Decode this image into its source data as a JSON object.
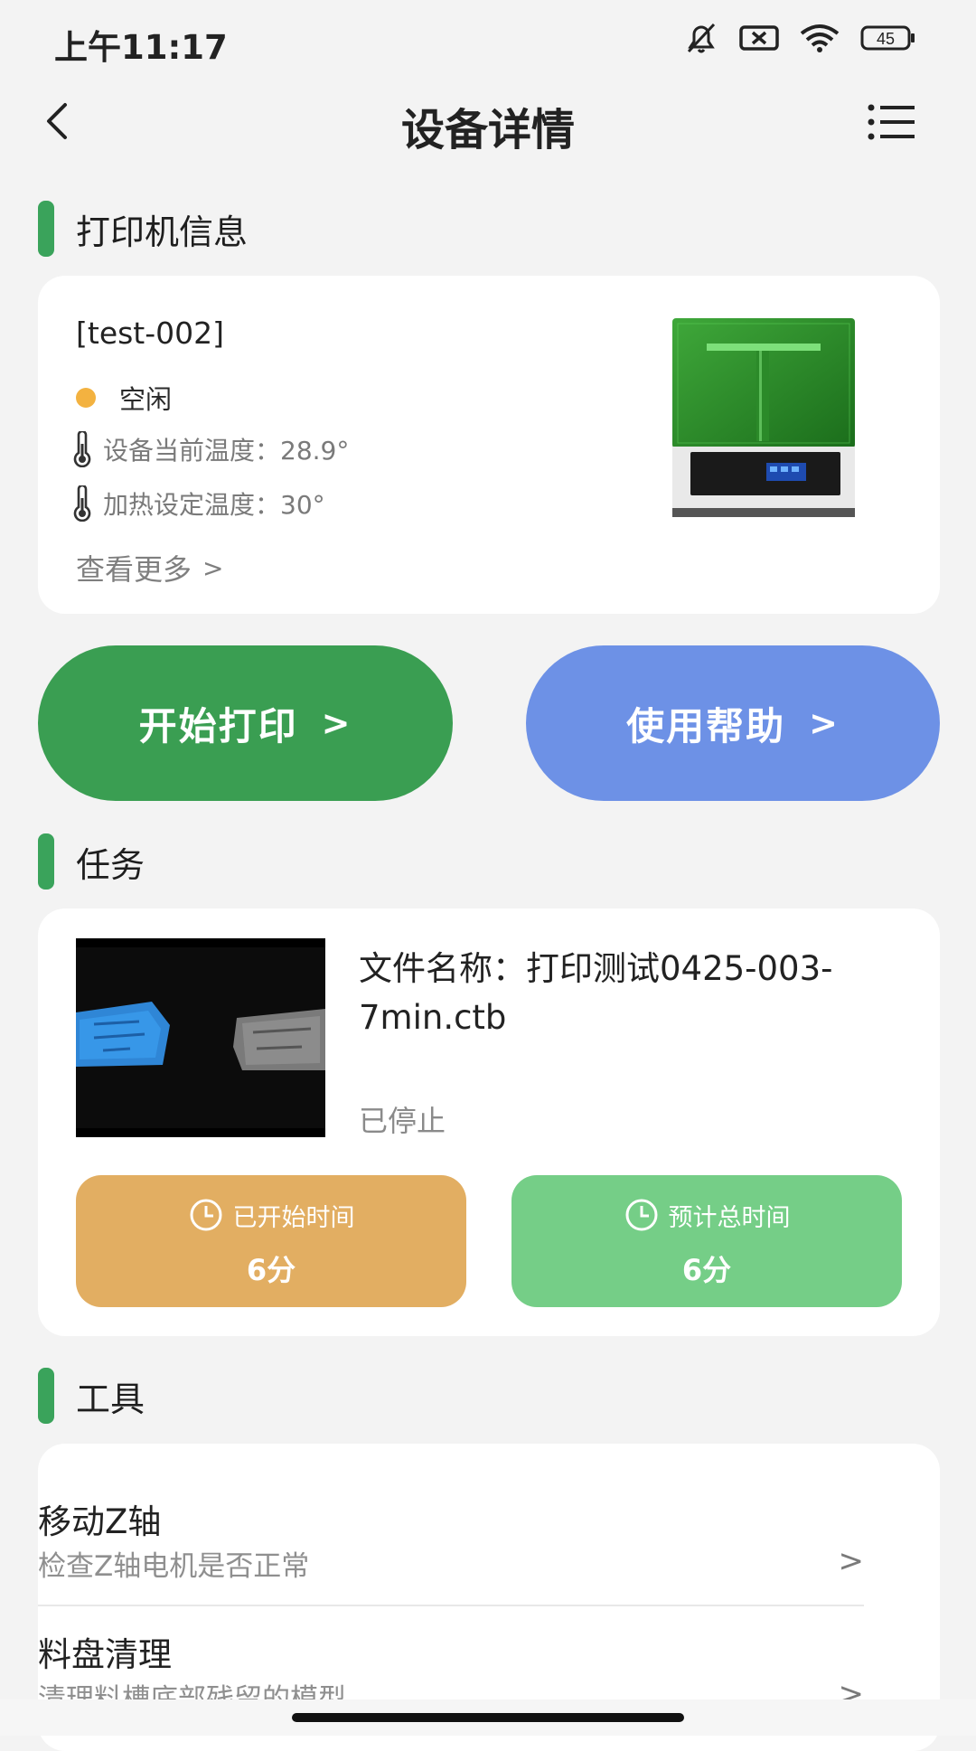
{
  "status_bar": {
    "time": "上午11:17",
    "battery": "45",
    "icons": [
      "bell-off-icon",
      "sim-x-icon",
      "wifi-icon",
      "battery-icon"
    ]
  },
  "nav": {
    "title": "设备详情",
    "back_icon": "chevron-left-icon",
    "menu_icon": "list-menu-icon"
  },
  "printer_section": {
    "title": "打印机信息",
    "device_name": "[test-002]",
    "status": "空闲",
    "status_color": "#f3b240",
    "current_temp": "设备当前温度：28.9°",
    "set_temp": "加热设定温度：30°",
    "more": "查看更多",
    "more_chevron": ">"
  },
  "actions": {
    "start_print": "开始打印",
    "help": "使用帮助",
    "chevron": ">"
  },
  "task_section": {
    "title": "任务",
    "file_name": "文件名称：打印测试0425-003-7min.ctb",
    "status": "已停止",
    "elapsed_label": "已开始时间",
    "elapsed_value": "6分",
    "total_label": "预计总时间",
    "total_value": "6分"
  },
  "tools_section": {
    "title": "工具",
    "items": [
      {
        "title": "移动Z轴",
        "desc": "检查Z轴电机是否正常",
        "chevron": ">"
      },
      {
        "title": "料盘清理",
        "desc": "清理料槽底部残留的模型",
        "chevron": ">"
      }
    ]
  },
  "colors": {
    "accent_green": "#3aa35b",
    "start_button": "#3a9e52",
    "help_button": "#6d91e6",
    "elapsed_box": "#e2ae62",
    "total_box": "#75ce87"
  }
}
